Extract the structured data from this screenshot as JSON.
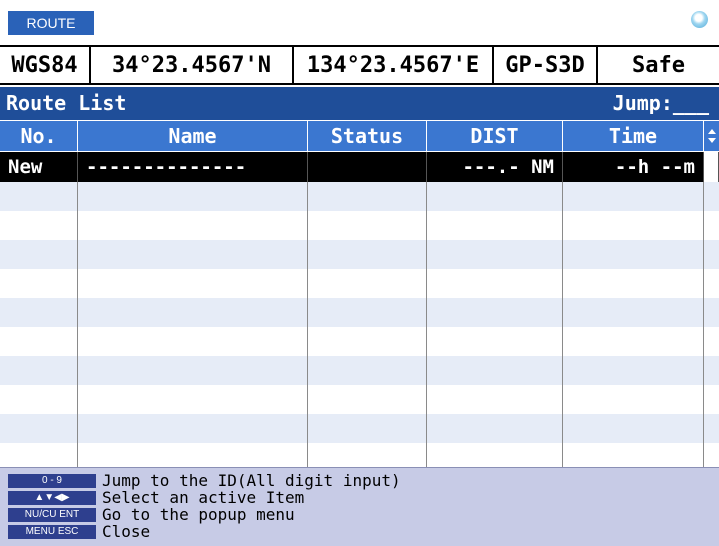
{
  "topbar": {
    "route_label": "ROUTE"
  },
  "position": {
    "datum": "WGS84",
    "latitude": "34°23.4567'N",
    "longitude": "134°23.4567'E",
    "fix": "GP-S3D",
    "state": "Safe"
  },
  "title": {
    "text": "Route List",
    "jump": "Jump:___"
  },
  "columns": {
    "no": "No.",
    "name": "Name",
    "status": "Status",
    "dist": "DIST",
    "time": "Time"
  },
  "new_row": {
    "no": "New",
    "name": "--------------",
    "status": "",
    "dist": "---.- NM",
    "time": "--h --m"
  },
  "help": [
    {
      "key": "0 - 9",
      "text": "Jump to the ID(All digit input)"
    },
    {
      "key": "▲▼◀▶",
      "text": "Select an active Item"
    },
    {
      "key": "NU/CU ENT",
      "text": "Go to the popup menu"
    },
    {
      "key": "MENU ESC",
      "text": "Close"
    }
  ],
  "colors": {
    "title_bg": "#1f4e99",
    "header_bg": "#3b77d0",
    "row_alt": "#e6ecf7",
    "footer_bg": "#c7cbe6"
  },
  "icons": {
    "status": "status-light-icon",
    "sort": "sort-arrows-icon"
  }
}
